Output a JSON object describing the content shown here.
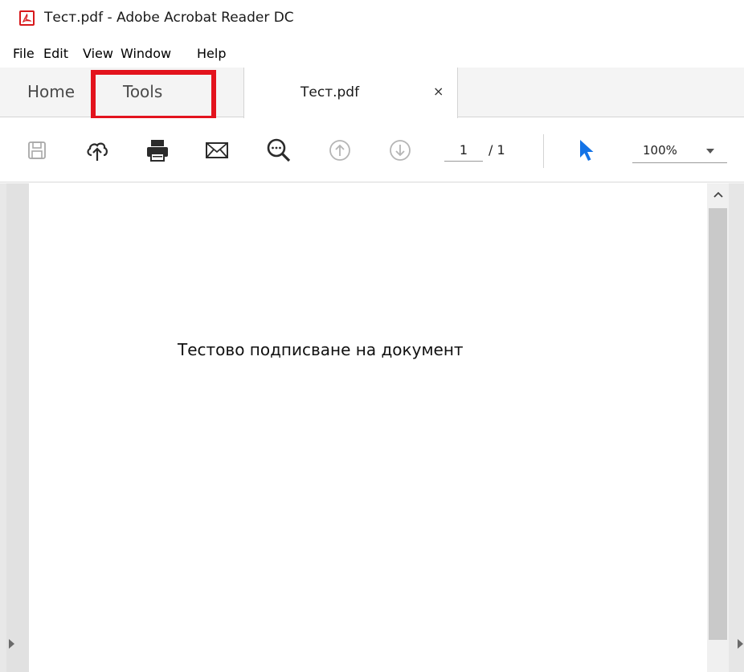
{
  "window": {
    "title": "Тест.pdf - Adobe Acrobat Reader DC",
    "icon": "acrobat-pdf-icon"
  },
  "menu": {
    "items": [
      "File",
      "Edit",
      "View",
      "Window",
      "Help"
    ]
  },
  "tabs": {
    "home_label": "Home",
    "tools_label": "Tools",
    "document_label": "Тест.pdf",
    "close_glyph": "×",
    "highlight_color": "#e3131d"
  },
  "toolbar": {
    "icons": [
      "save-icon",
      "cloud-upload-icon",
      "print-icon",
      "email-icon",
      "zoom-search-icon",
      "page-up-icon",
      "page-down-icon",
      "select-cursor-icon"
    ],
    "current_page": "1",
    "total_pages": "/ 1",
    "zoom": "100%",
    "cursor_color": "#1473e6"
  },
  "document": {
    "text": "Тестово подписване на документ"
  }
}
